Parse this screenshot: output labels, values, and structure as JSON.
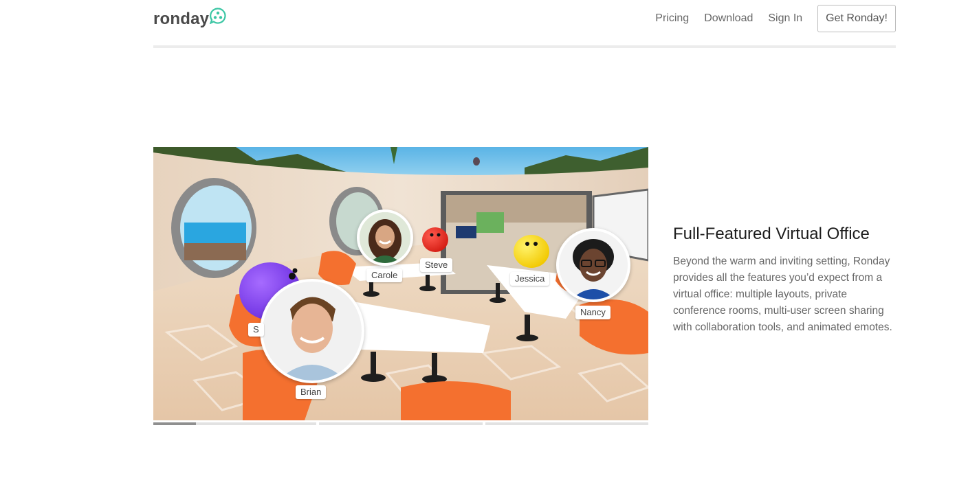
{
  "header": {
    "logo_text": "ronday",
    "nav": {
      "pricing": "Pricing",
      "download": "Download",
      "sign_in": "Sign In",
      "cta": "Get Ronday!"
    }
  },
  "hero": {
    "participants": {
      "carole": "Carole",
      "steve": "Steve",
      "jessica": "Jessica",
      "nancy": "Nancy",
      "brian": "Brian",
      "partial": "S"
    }
  },
  "carousel": {
    "slides": 3,
    "active_index": 0,
    "active_progress_percent": 26
  },
  "feature": {
    "title": "Full-Featured Virtual Office",
    "body": "Beyond the warm and inviting setting, Ronday provides all the features you’d expect from a virtual office: multiple layouts, private conference rooms, multi-user screen sharing with collaboration tools, and animated emotes."
  },
  "colors": {
    "brand": "#3cc6a4",
    "chair": "#f4702f"
  }
}
